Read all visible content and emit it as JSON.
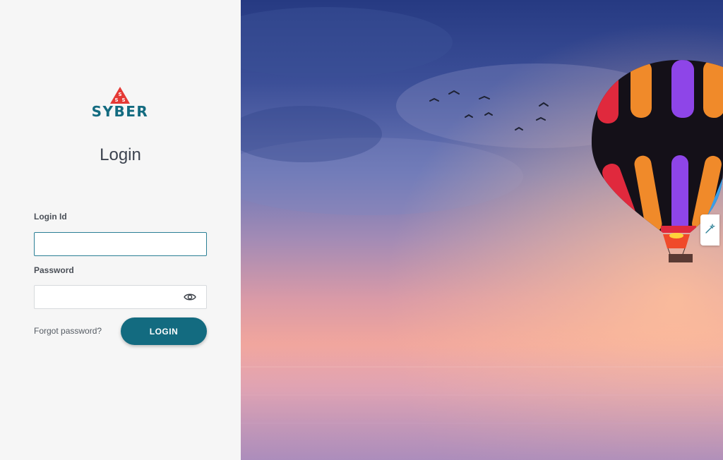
{
  "brand": {
    "logo_text": "SYBER",
    "logo_color": "#136b80",
    "mark_color": "#e53935"
  },
  "page": {
    "title": "Login"
  },
  "form": {
    "login_id": {
      "label": "Login Id",
      "value": "",
      "placeholder": ""
    },
    "password": {
      "label": "Password",
      "value": "",
      "placeholder": "",
      "toggle_icon": "eye-icon"
    },
    "forgot_link": "Forgot password?",
    "submit_label": "LOGIN"
  },
  "hero": {
    "image": "hot-air-balloon-sunset"
  },
  "side_tool": {
    "icon": "magic-wand-icon"
  }
}
